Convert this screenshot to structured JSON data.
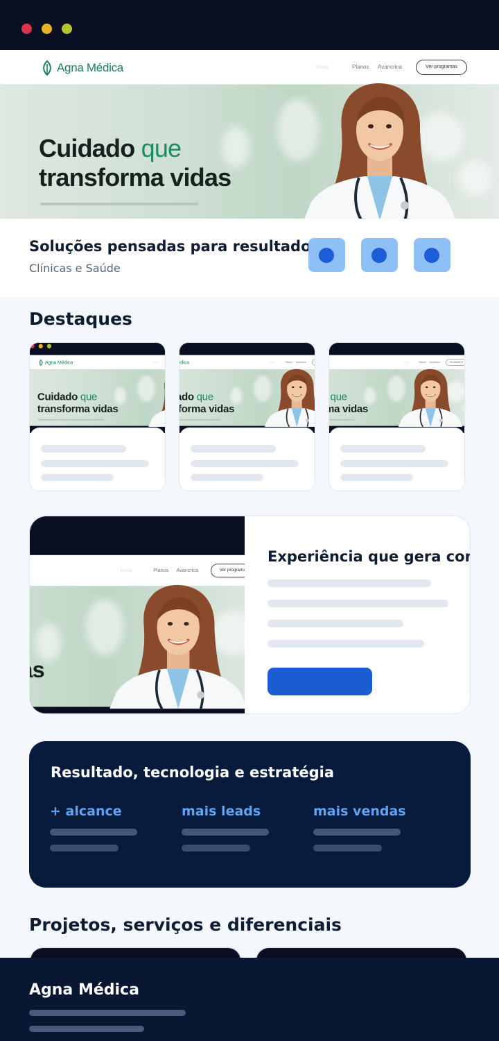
{
  "mockup": {
    "brand": "Agna Médica",
    "nav_links": [
      "Planos",
      "Avancrica"
    ],
    "nav_cta": "Ver programas",
    "hero_title_line1_a": "Cuidado",
    "hero_title_line1_b": "que",
    "hero_title_line2": "transforma vidas"
  },
  "intro": {
    "title": "Soluções pensadas para resultados",
    "subtitle": "Clínicas e Saúde",
    "icons": [
      "feature-icon-1",
      "feature-icon-2",
      "feature-icon-3"
    ]
  },
  "highlights": {
    "title": "Destaques"
  },
  "feature": {
    "title": "Experiência que gera confiança"
  },
  "results": {
    "title": "Resultado, tecnologia e estratégia",
    "stats": [
      "+ alcance",
      "mais leads",
      "mais vendas"
    ]
  },
  "projects": {
    "title": "Projetos, serviços e diferenciais"
  },
  "footer": {
    "brand": "Agna Médica"
  },
  "colors": {
    "navy": "#091b3d",
    "accent_blue": "#1a5dd0",
    "stat_blue": "#5ea2f4",
    "brand_green": "#1d8a66"
  }
}
